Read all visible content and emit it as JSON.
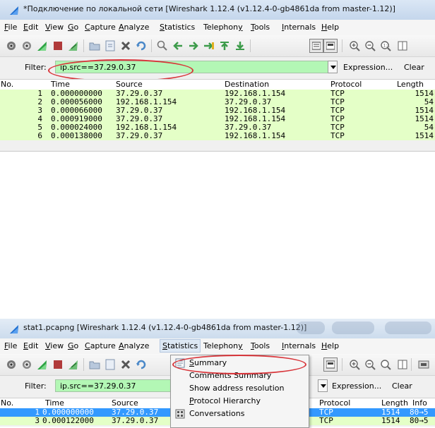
{
  "window1": {
    "title": "*Подключение по локальной сети  [Wireshark 1.12.4  (v1.12.4-0-gb4861da from master-1.12)]",
    "menu": [
      {
        "label": "File",
        "u": "F"
      },
      {
        "label": "Edit",
        "u": "E"
      },
      {
        "label": "View",
        "u": "V"
      },
      {
        "label": "Go",
        "u": "G"
      },
      {
        "label": "Capture",
        "u": "C"
      },
      {
        "label": "Analyze",
        "u": "A"
      },
      {
        "label": "Statistics",
        "u": "S"
      },
      {
        "label": "Telephony",
        "u": "y"
      },
      {
        "label": "Tools",
        "u": "T"
      },
      {
        "label": "Internals",
        "u": "I"
      },
      {
        "label": "Help",
        "u": "H"
      }
    ],
    "filter": {
      "label": "Filter:",
      "value": "ip.src==37.29.0.37",
      "expression_label": "Expression...",
      "clear_label": "Clear"
    },
    "columns": [
      "No.",
      "Time",
      "Source",
      "Destination",
      "Protocol",
      "Length"
    ],
    "rows": [
      [
        "1",
        "0.000000000",
        "37.29.0.37",
        "192.168.1.154",
        "TCP",
        "1514"
      ],
      [
        "2",
        "0.000056000",
        "192.168.1.154",
        "37.29.0.37",
        "TCP",
        "54"
      ],
      [
        "3",
        "0.000066000",
        "37.29.0.37",
        "192.168.1.154",
        "TCP",
        "1514"
      ],
      [
        "4",
        "0.000919000",
        "37.29.0.37",
        "192.168.1.154",
        "TCP",
        "1514"
      ],
      [
        "5",
        "0.000024000",
        "192.168.1.154",
        "37.29.0.37",
        "TCP",
        "54"
      ],
      [
        "6",
        "0.000138000",
        "37.29.0.37",
        "192.168.1.154",
        "TCP",
        "1514"
      ]
    ]
  },
  "window2": {
    "title": "stat1.pcapng  [Wireshark 1.12.4  (v1.12.4-0-gb4861da from master-1.12)]",
    "menu": [
      {
        "label": "File",
        "u": "F"
      },
      {
        "label": "Edit",
        "u": "E"
      },
      {
        "label": "View",
        "u": "V"
      },
      {
        "label": "Go",
        "u": "G"
      },
      {
        "label": "Capture",
        "u": "C"
      },
      {
        "label": "Analyze",
        "u": "A"
      },
      {
        "label": "Statistics",
        "u": "S"
      },
      {
        "label": "Telephony",
        "u": "y"
      },
      {
        "label": "Tools",
        "u": "T"
      },
      {
        "label": "Internals",
        "u": "I"
      },
      {
        "label": "Help",
        "u": "H"
      }
    ],
    "filter": {
      "label": "Filter:",
      "value": "ip.src==37.29.0.37",
      "expression_label": "Expression...",
      "clear_label": "Clear"
    },
    "columns": [
      "No.",
      "Time",
      "Source",
      "Protocol",
      "Length",
      "Info"
    ],
    "rows": [
      {
        "no": "1",
        "time": "0.000000000",
        "source": "37.29.0.37",
        "protocol": "TCP",
        "length": "1514",
        "info": "80→5",
        "selected": true
      },
      {
        "no": "3",
        "time": "0.000122000",
        "source": "37.29.0.37",
        "protocol": "TCP",
        "length": "1514",
        "info": "80→5",
        "selected": false
      }
    ],
    "statistics_menu": [
      {
        "label": "Summary",
        "u": "S",
        "icon": "summary-icon"
      },
      {
        "label": "Comments Summary",
        "u": "",
        "icon": ""
      },
      {
        "label": "Show address resolution",
        "u": "",
        "icon": ""
      },
      {
        "label": "Protocol Hierarchy",
        "u": "P",
        "icon": ""
      },
      {
        "label": "Conversations",
        "u": "",
        "icon": "conversations-icon"
      }
    ]
  },
  "colors": {
    "filter_valid_bg": "#b3f7b5",
    "row_highlight": "#e4ffc7",
    "selection": "#3399ff",
    "annotation_red": "#d8353a"
  }
}
